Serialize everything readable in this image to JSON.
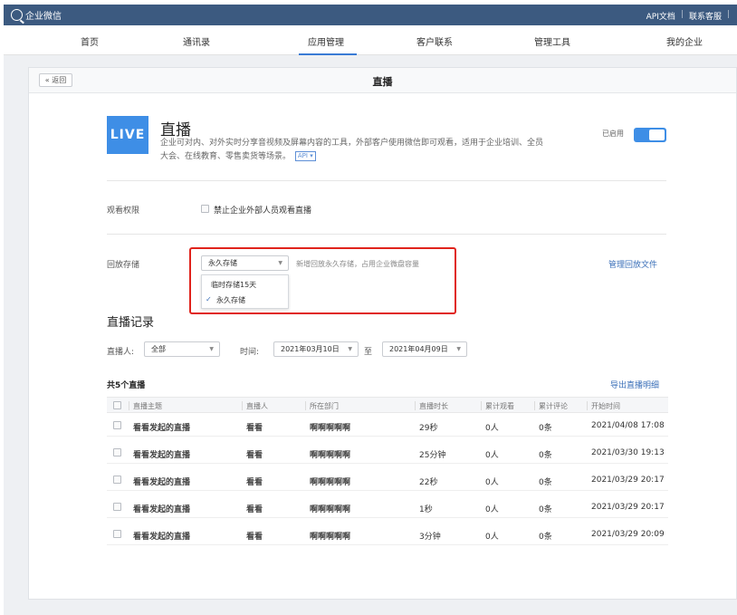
{
  "topbar": {
    "logo_text": "企业微信",
    "links": [
      "API文档",
      "联系客服"
    ],
    "color": "#3c5a80"
  },
  "nav": {
    "items": [
      "首页",
      "通讯录",
      "应用管理",
      "客户联系",
      "管理工具",
      "我的企业"
    ],
    "active": "应用管理"
  },
  "panel": {
    "back_label": "« 返回",
    "title": "直播"
  },
  "app": {
    "badge": "LIVE",
    "name": "直播",
    "desc_line1": "企业可对内、对外实时分享音视频及屏幕内容的工具，外部客户使用微信即可观看，适用于企业培训、全员",
    "desc_line2": "大会、在线教育、零售卖货等场景。",
    "api_tag": "API ▾",
    "enabled_label": "已启用",
    "enabled": true
  },
  "permission": {
    "label": "观看权限",
    "option": "禁止企业外部人员观看直播",
    "checked": false
  },
  "storage": {
    "label": "回放存储",
    "selected": "永久存储",
    "hint": "新增回放永久存储，占用企业微盘容量",
    "manage_link": "管理回放文件",
    "options": [
      "临时存储15天",
      "永久存储"
    ],
    "selected_mark": "✓"
  },
  "records": {
    "title": "直播记录",
    "host_label": "直播人:",
    "host_value": "全部",
    "time_label": "时间:",
    "date_from": "2021年03月10日",
    "date_to": "2021年04月09日",
    "to_label": "至",
    "count_text": "共5个直播",
    "export_link": "导出直播明细",
    "columns": [
      "直播主题",
      "直播人",
      "所在部门",
      "直播时长",
      "累计观看",
      "累计评论",
      "开始时间"
    ],
    "rows": [
      [
        "看看发起的直播",
        "看看",
        "啊啊啊啊啊",
        "29秒",
        "0人",
        "0条",
        "2021/04/08 17:08"
      ],
      [
        "看看发起的直播",
        "看看",
        "啊啊啊啊啊",
        "25分钟",
        "0人",
        "0条",
        "2021/03/30 19:13"
      ],
      [
        "看看发起的直播",
        "看看",
        "啊啊啊啊啊",
        "22秒",
        "0人",
        "0条",
        "2021/03/29 20:17"
      ],
      [
        "看看发起的直播",
        "看看",
        "啊啊啊啊啊",
        "1秒",
        "0人",
        "0条",
        "2021/03/29 20:17"
      ],
      [
        "看看发起的直播",
        "看看",
        "啊啊啊啊啊",
        "3分钟",
        "0人",
        "0条",
        "2021/03/29 20:09"
      ]
    ]
  },
  "icons": {
    "logo": "chat-bubble-icon",
    "dropdown": "chevron-down-icon",
    "check": "check-icon"
  },
  "colors": {
    "accent": "#3e8ee6",
    "link": "#3a6fb8",
    "highlight_box": "#e0231c"
  }
}
